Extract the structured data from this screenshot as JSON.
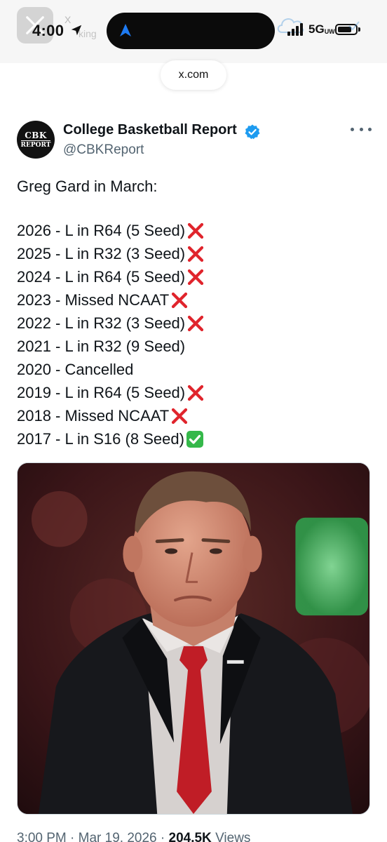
{
  "status_bar": {
    "time": "4:00",
    "network": "5G",
    "network_suffix": "UW",
    "battery_level": 0.8,
    "ghost_app_label": "X",
    "ghost_app_sub": "king"
  },
  "browser": {
    "url": "x.com"
  },
  "tweet": {
    "display_name": "College Basketball Report",
    "handle": "@CBKReport",
    "avatar_text_top": "CBK",
    "avatar_text_bottom": "REPORT",
    "verified": true,
    "intro": "Greg Gard in March:",
    "lines": [
      {
        "text": "2026 - L in R64 (5 Seed)",
        "mark": "cross"
      },
      {
        "text": "2025 - L in R32 (3 Seed)",
        "mark": "cross"
      },
      {
        "text": "2024 - L in R64 (5 Seed)",
        "mark": "cross"
      },
      {
        "text": "2023 - Missed NCAAT",
        "mark": "cross"
      },
      {
        "text": "2022 - L in R32 (3 Seed)",
        "mark": "cross"
      },
      {
        "text": "2021 - L in R32 (9 Seed)",
        "mark": "none"
      },
      {
        "text": "2020 - Cancelled",
        "mark": "none"
      },
      {
        "text": "2019 - L in R64 (5 Seed)",
        "mark": "cross"
      },
      {
        "text": "2018 - Missed NCAAT",
        "mark": "cross"
      },
      {
        "text": "2017 - L in S16 (8 Seed)",
        "mark": "check"
      }
    ],
    "meta": {
      "time": "3:00 PM",
      "separator": " · ",
      "date": "Mar 19, 2026",
      "views_count": "204.5K",
      "views_label": "Views"
    }
  },
  "colors": {
    "verified": "#1d9bf0",
    "cross": "#e0242c",
    "check_bg": "#35b84a",
    "secondary_text": "#536471"
  },
  "icons": {
    "more": "more-horizontal-icon",
    "verified": "verified-badge-icon",
    "cross": "cross-mark-icon",
    "check": "check-mark-button-icon"
  }
}
